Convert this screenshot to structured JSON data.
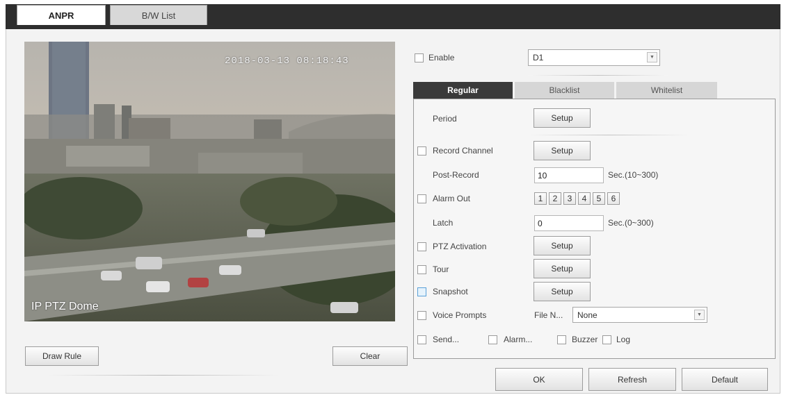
{
  "top_tabs": [
    {
      "label": "ANPR"
    },
    {
      "label": "B/W List"
    }
  ],
  "video": {
    "timestamp": "2018-03-13 08:18:43",
    "camera_name": "IP PTZ Dome"
  },
  "left_buttons": {
    "draw_rule": "Draw Rule",
    "clear": "Clear"
  },
  "enable": {
    "label": "Enable",
    "resolution_value": "D1"
  },
  "sub_tabs": [
    {
      "label": "Regular"
    },
    {
      "label": "Blacklist"
    },
    {
      "label": "Whitelist"
    }
  ],
  "regular": {
    "period_label": "Period",
    "setup_label": "Setup",
    "record_channel_label": "Record Channel",
    "post_record_label": "Post-Record",
    "post_record_value": "10",
    "post_record_unit": "Sec.(10~300)",
    "alarm_out_label": "Alarm Out",
    "alarm_out_channels": [
      "1",
      "2",
      "3",
      "4",
      "5",
      "6"
    ],
    "latch_label": "Latch",
    "latch_value": "0",
    "latch_unit": "Sec.(0~300)",
    "ptz_activation_label": "PTZ Activation",
    "tour_label": "Tour",
    "snapshot_label": "Snapshot",
    "voice_prompts_label": "Voice Prompts",
    "file_name_label": "File N...",
    "file_name_value": "None",
    "send_label": "Send...",
    "alarm_label": "Alarm...",
    "buzzer_label": "Buzzer",
    "log_label": "Log"
  },
  "bottom_buttons": {
    "ok": "OK",
    "refresh": "Refresh",
    "default": "Default"
  },
  "colors": {
    "topbar": "#2e2e2e",
    "active_subtab": "#3a3a3a",
    "inactive_subtab": "#d6d6d6",
    "panel_bg": "#f6f6f6"
  },
  "icons": {
    "dropdown": "chevron-down-icon"
  }
}
